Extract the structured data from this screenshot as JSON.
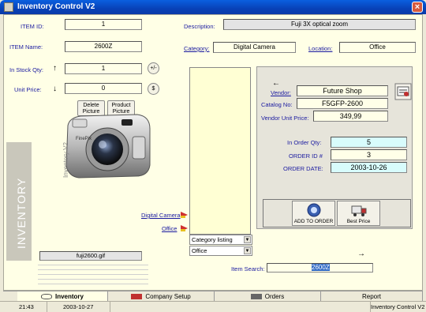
{
  "window": {
    "title": "Inventory Control  V2"
  },
  "item": {
    "id_label": "ITEM ID:",
    "id_value": "1",
    "name_label": "ITEM Name:",
    "name_value": "2600Z",
    "stock_label": "In Stock Qty:",
    "stock_value": "1",
    "stock_btn": "+/-",
    "price_label": "Unit Price:",
    "price_value": "0",
    "price_btn": "$",
    "delete_picture": [
      "Delete",
      "Picture"
    ],
    "product_picture": [
      "Product",
      "Picture"
    ],
    "filename": "fuji2600.gif",
    "side_label": "INVENTORY"
  },
  "details": {
    "description_label": "Description:",
    "description_value": "Fuji 3X optical zoom",
    "category_label": "Category:",
    "category_value": "Digital Camera",
    "location_label": "Location:",
    "location_value": "Office"
  },
  "lists": {
    "link_category": "Digital Camera",
    "link_location": "Office",
    "category_select": "Category listing",
    "location_select": "Office"
  },
  "vendor": {
    "vendor_label": "Vendor:",
    "vendor_value": "Future Shop",
    "catalog_label": "Catalog No:",
    "catalog_value": "F5GFP-2600",
    "price_label": "Vendor Unit Price:",
    "price_value": "349,99",
    "order_qty_label": "In Order Qty:",
    "order_qty_value": "5",
    "order_id_label": "ORDER ID #",
    "order_id_value": "3",
    "order_date_label": "ORDER DATE:",
    "order_date_value": "2003-10-26",
    "add_to_order": "ADD TO ORDER",
    "best_price": "Best Price"
  },
  "search": {
    "label": "Item Search:",
    "value": "2600Z"
  },
  "tabs": [
    {
      "label": "Inventory"
    },
    {
      "label": "Company Setup"
    },
    {
      "label": "Orders"
    },
    {
      "label": "Report"
    }
  ],
  "status": {
    "time": "21:43",
    "date": "2003-10-27",
    "app": "Inventory Control V2"
  }
}
